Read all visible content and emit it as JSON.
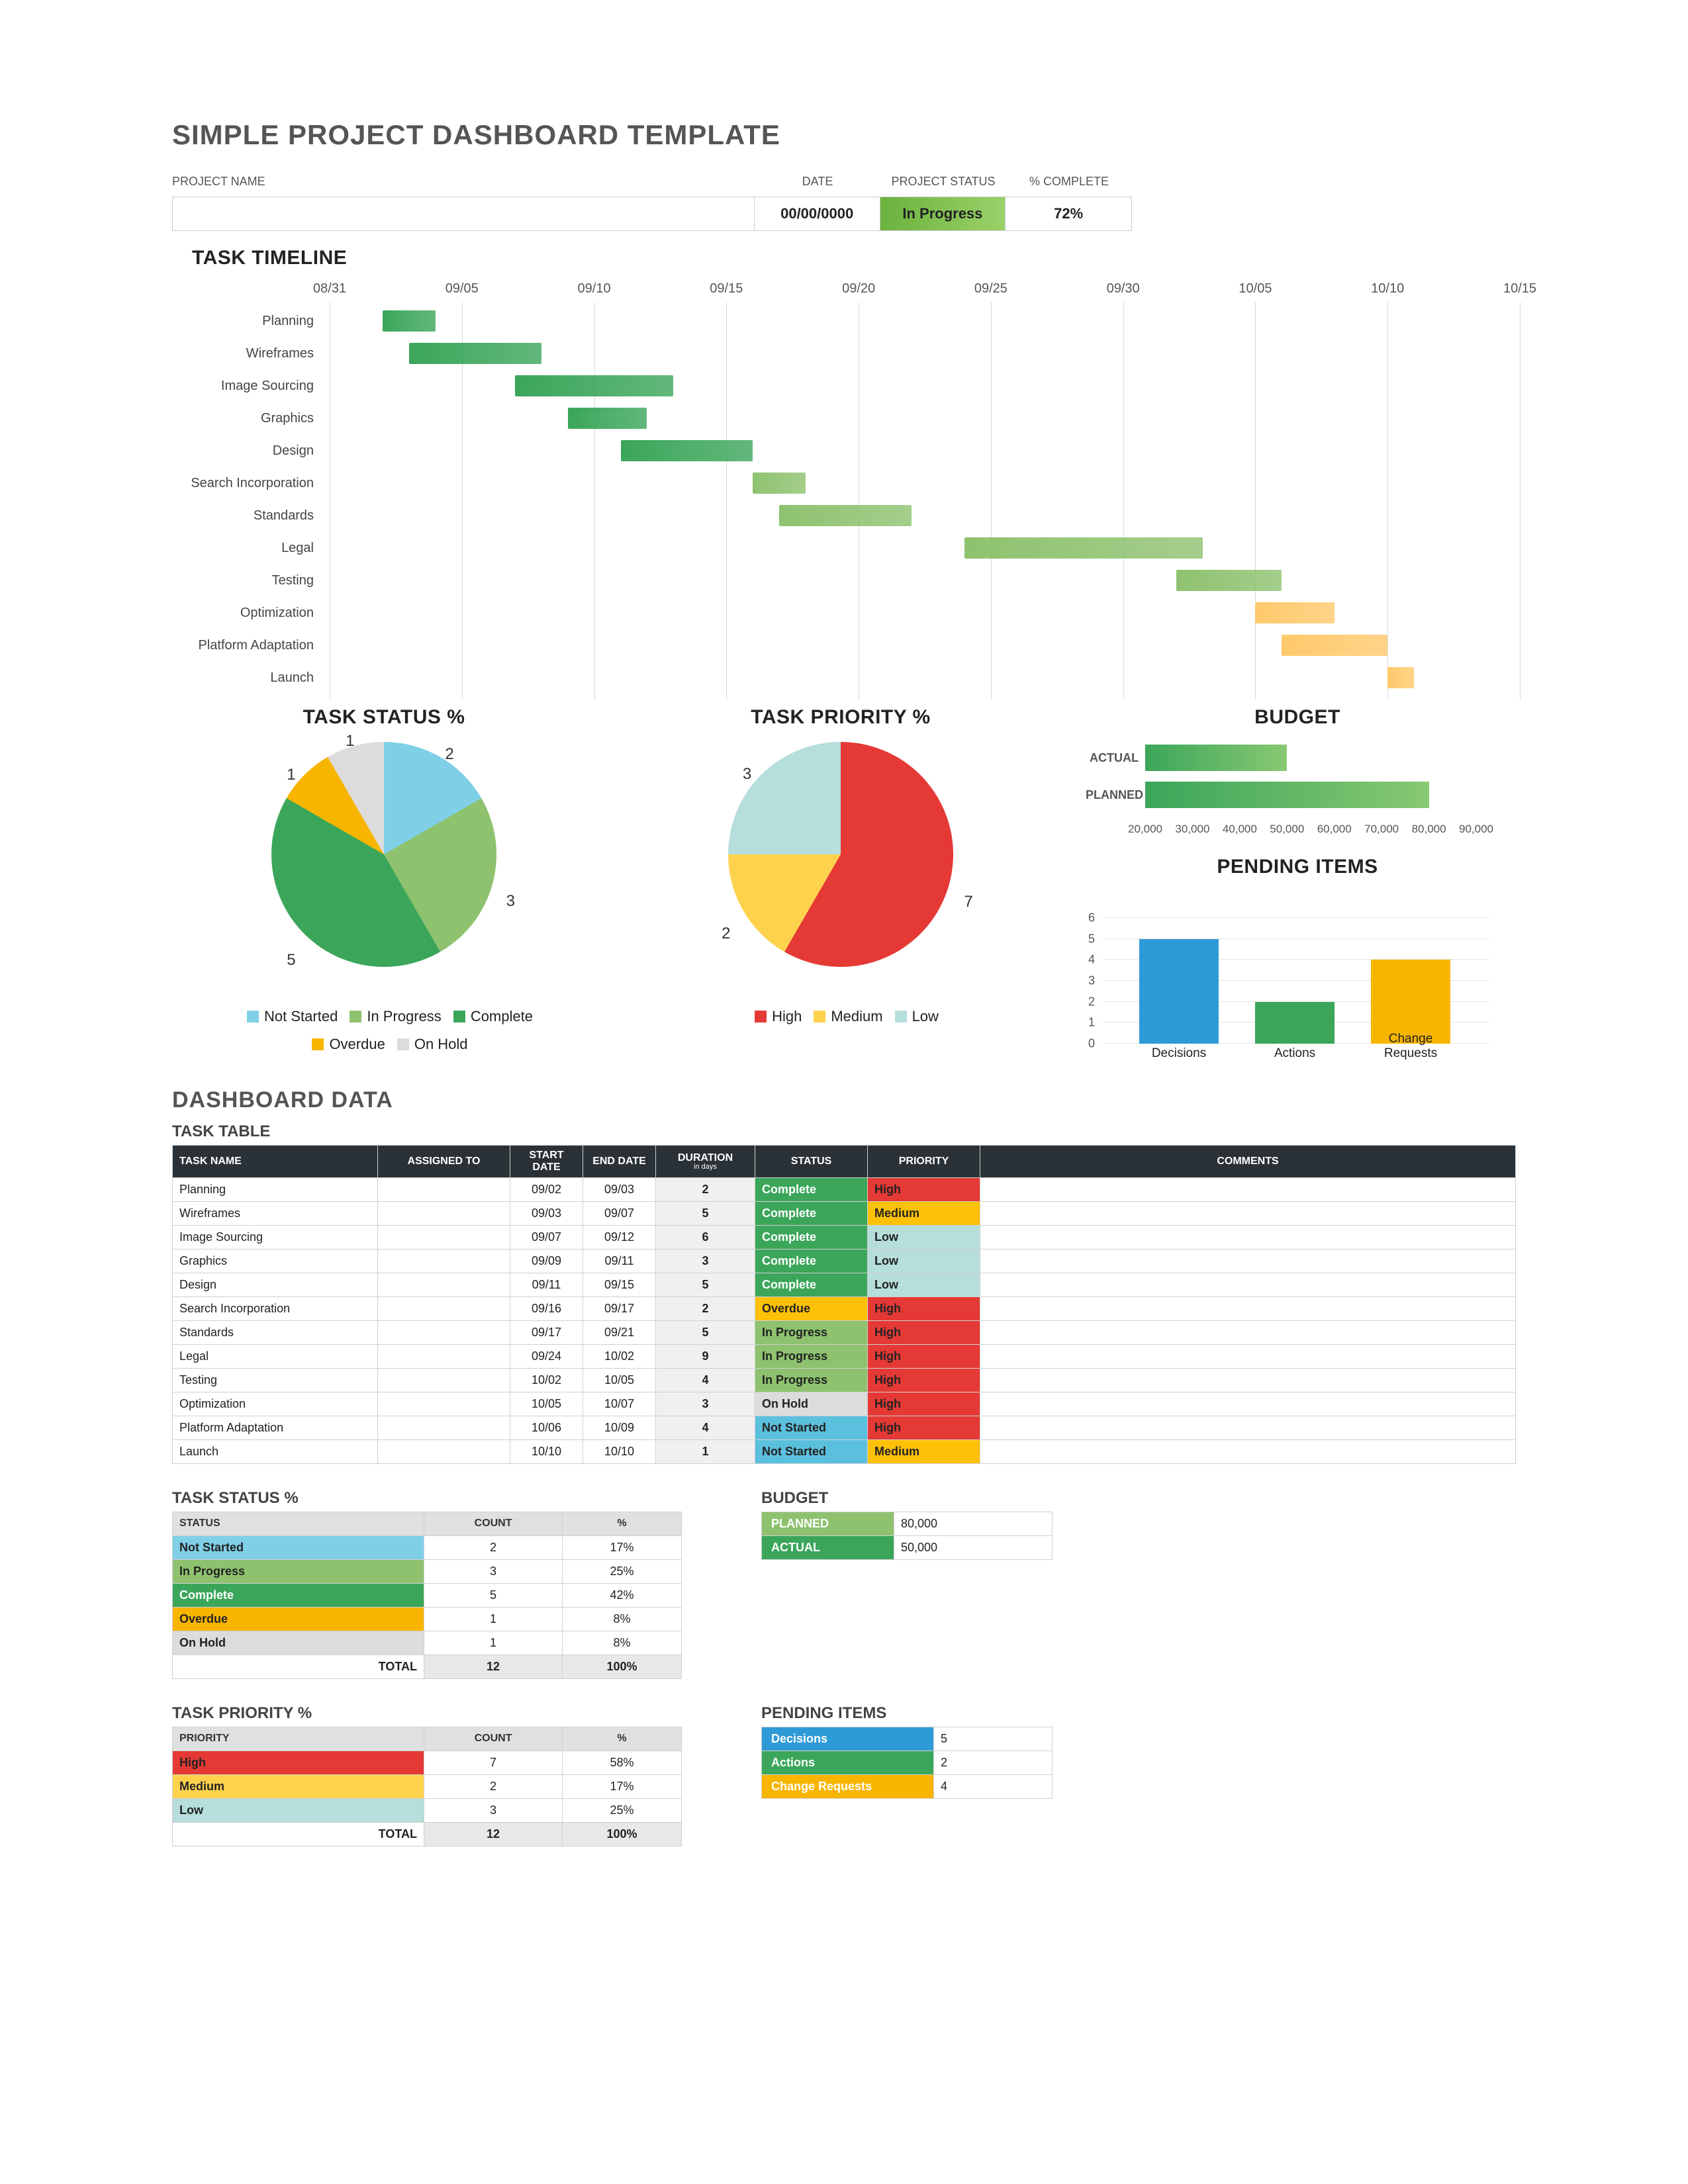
{
  "title": "SIMPLE PROJECT DASHBOARD TEMPLATE",
  "header": {
    "labels": {
      "name": "PROJECT NAME",
      "date": "DATE",
      "status": "PROJECT  STATUS",
      "pct": "% COMPLETE"
    },
    "values": {
      "name": "",
      "date": "00/00/0000",
      "status": "In Progress",
      "pct": "72%"
    }
  },
  "sections": {
    "timeline": "TASK TIMELINE",
    "status_pie": "TASK STATUS %",
    "priority_pie": "TASK PRIORITY %",
    "budget": "BUDGET",
    "pending": "PENDING ITEMS",
    "dashboard": "DASHBOARD DATA",
    "task_table": "TASK TABLE",
    "status_table": "TASK STATUS %",
    "priority_table": "TASK PRIORITY %",
    "budget_table": "BUDGET",
    "pending_table": "PENDING ITEMS"
  },
  "status_legend": [
    "Not Started",
    "In Progress",
    "Complete",
    "Overdue",
    "On Hold"
  ],
  "priority_legend": [
    "High",
    "Medium",
    "Low"
  ],
  "task_headers": [
    "TASK NAME",
    "ASSIGNED TO",
    "START DATE",
    "END DATE",
    "DURATION",
    "STATUS",
    "PRIORITY",
    "COMMENTS"
  ],
  "duration_sub": "in days",
  "status_headers": [
    "STATUS",
    "COUNT",
    "%"
  ],
  "priority_headers": [
    "PRIORITY",
    "COUNT",
    "%"
  ],
  "budget_labels": {
    "actual": "ACTUAL",
    "planned": "PLANNED"
  },
  "total_label": "TOTAL",
  "chart_data": [
    {
      "type": "gantt",
      "title": "TASK TIMELINE",
      "x_ticks": [
        "08/31",
        "09/05",
        "09/10",
        "09/15",
        "09/20",
        "09/25",
        "09/30",
        "10/05",
        "10/10",
        "10/15"
      ],
      "x_range": [
        "08/31",
        "10/15"
      ],
      "tasks": [
        {
          "name": "Planning",
          "start": "09/02",
          "end": "09/03",
          "color": "#3ba65a"
        },
        {
          "name": "Wireframes",
          "start": "09/03",
          "end": "09/07",
          "color": "#3ba65a"
        },
        {
          "name": "Image Sourcing",
          "start": "09/07",
          "end": "09/12",
          "color": "#3ba65a"
        },
        {
          "name": "Graphics",
          "start": "09/09",
          "end": "09/11",
          "color": "#3ba65a"
        },
        {
          "name": "Design",
          "start": "09/11",
          "end": "09/15",
          "color": "#3ba65a"
        },
        {
          "name": "Search Incorporation",
          "start": "09/16",
          "end": "09/17",
          "color": "#8ec26f"
        },
        {
          "name": "Standards",
          "start": "09/17",
          "end": "09/21",
          "color": "#8ec26f"
        },
        {
          "name": "Legal",
          "start": "09/24",
          "end": "10/02",
          "color": "#8ec26f"
        },
        {
          "name": "Testing",
          "start": "10/02",
          "end": "10/05",
          "color": "#8ec26f"
        },
        {
          "name": "Optimization",
          "start": "10/05",
          "end": "10/07",
          "color": "#ffc96b"
        },
        {
          "name": "Platform Adaptation",
          "start": "10/06",
          "end": "10/09",
          "color": "#ffc96b"
        },
        {
          "name": "Launch",
          "start": "10/10",
          "end": "10/10",
          "color": "#ffc96b"
        }
      ]
    },
    {
      "type": "pie",
      "title": "TASK STATUS %",
      "series": [
        {
          "name": "Not Started",
          "value": 2,
          "color": "#7fd0e7"
        },
        {
          "name": "In Progress",
          "value": 3,
          "color": "#8ec26f"
        },
        {
          "name": "Complete",
          "value": 5,
          "color": "#3ba65a"
        },
        {
          "name": "Overdue",
          "value": 1,
          "color": "#f8b500"
        },
        {
          "name": "On Hold",
          "value": 1,
          "color": "#dcdcdc"
        }
      ]
    },
    {
      "type": "pie",
      "title": "TASK PRIORITY %",
      "series": [
        {
          "name": "High",
          "value": 7,
          "color": "#e53935"
        },
        {
          "name": "Medium",
          "value": 2,
          "color": "#ffd24d"
        },
        {
          "name": "Low",
          "value": 3,
          "color": "#b6dedb"
        }
      ]
    },
    {
      "type": "bar",
      "title": "BUDGET",
      "orientation": "horizontal",
      "categories": [
        "ACTUAL",
        "PLANNED"
      ],
      "values": [
        50000,
        80000
      ],
      "xticks": [
        20000,
        30000,
        40000,
        50000,
        60000,
        70000,
        80000,
        90000
      ],
      "xlim": [
        20000,
        90000
      ]
    },
    {
      "type": "bar",
      "title": "PENDING ITEMS",
      "categories": [
        "Decisions",
        "Actions",
        "Change Requests"
      ],
      "values": [
        5,
        2,
        4
      ],
      "colors": [
        "#2e9bd6",
        "#3ba65a",
        "#f8b500"
      ],
      "ylim": [
        0,
        6
      ],
      "grid": true
    }
  ],
  "tasks": [
    {
      "name": "Planning",
      "assigned": "",
      "start": "09/02",
      "end": "09/03",
      "dur": "2",
      "status": "Complete",
      "priority": "High",
      "comments": ""
    },
    {
      "name": "Wireframes",
      "assigned": "",
      "start": "09/03",
      "end": "09/07",
      "dur": "5",
      "status": "Complete",
      "priority": "Medium",
      "comments": ""
    },
    {
      "name": "Image Sourcing",
      "assigned": "",
      "start": "09/07",
      "end": "09/12",
      "dur": "6",
      "status": "Complete",
      "priority": "Low",
      "comments": ""
    },
    {
      "name": "Graphics",
      "assigned": "",
      "start": "09/09",
      "end": "09/11",
      "dur": "3",
      "status": "Complete",
      "priority": "Low",
      "comments": ""
    },
    {
      "name": "Design",
      "assigned": "",
      "start": "09/11",
      "end": "09/15",
      "dur": "5",
      "status": "Complete",
      "priority": "Low",
      "comments": ""
    },
    {
      "name": "Search Incorporation",
      "assigned": "",
      "start": "09/16",
      "end": "09/17",
      "dur": "2",
      "status": "Overdue",
      "priority": "High",
      "comments": ""
    },
    {
      "name": "Standards",
      "assigned": "",
      "start": "09/17",
      "end": "09/21",
      "dur": "5",
      "status": "In Progress",
      "priority": "High",
      "comments": ""
    },
    {
      "name": "Legal",
      "assigned": "",
      "start": "09/24",
      "end": "10/02",
      "dur": "9",
      "status": "In Progress",
      "priority": "High",
      "comments": ""
    },
    {
      "name": "Testing",
      "assigned": "",
      "start": "10/02",
      "end": "10/05",
      "dur": "4",
      "status": "In Progress",
      "priority": "High",
      "comments": ""
    },
    {
      "name": "Optimization",
      "assigned": "",
      "start": "10/05",
      "end": "10/07",
      "dur": "3",
      "status": "On Hold",
      "priority": "High",
      "comments": ""
    },
    {
      "name": "Platform Adaptation",
      "assigned": "",
      "start": "10/06",
      "end": "10/09",
      "dur": "4",
      "status": "Not Started",
      "priority": "High",
      "comments": ""
    },
    {
      "name": "Launch",
      "assigned": "",
      "start": "10/10",
      "end": "10/10",
      "dur": "1",
      "status": "Not Started",
      "priority": "Medium",
      "comments": ""
    }
  ],
  "status_summary": [
    {
      "status": "Not Started",
      "count": 2,
      "pct": "17%",
      "color": "#7fd0e7"
    },
    {
      "status": "In Progress",
      "count": 3,
      "pct": "25%",
      "color": "#8ec26f"
    },
    {
      "status": "Complete",
      "count": 5,
      "pct": "42%",
      "color": "#3ba65a"
    },
    {
      "status": "Overdue",
      "count": 1,
      "pct": "8%",
      "color": "#f8b500"
    },
    {
      "status": "On Hold",
      "count": 1,
      "pct": "8%",
      "color": "#dcdcdc"
    }
  ],
  "status_total": {
    "count": 12,
    "pct": "100%"
  },
  "priority_summary": [
    {
      "priority": "High",
      "count": 7,
      "pct": "58%",
      "color": "#e53935"
    },
    {
      "priority": "Medium",
      "count": 2,
      "pct": "17%",
      "color": "#ffd24d"
    },
    {
      "priority": "Low",
      "count": 3,
      "pct": "25%",
      "color": "#b6dedb"
    }
  ],
  "priority_total": {
    "count": 12,
    "pct": "100%"
  },
  "budget_table": [
    {
      "label": "PLANNED",
      "value": "80,000",
      "color": "#8ec26f"
    },
    {
      "label": "ACTUAL",
      "value": "50,000",
      "color": "#3ba65a"
    }
  ],
  "pending_table": [
    {
      "label": "Decisions",
      "value": 5,
      "color": "#2e9bd6"
    },
    {
      "label": "Actions",
      "value": 2,
      "color": "#3ba65a"
    },
    {
      "label": "Change Requests",
      "value": 4,
      "color": "#f8b500"
    }
  ]
}
